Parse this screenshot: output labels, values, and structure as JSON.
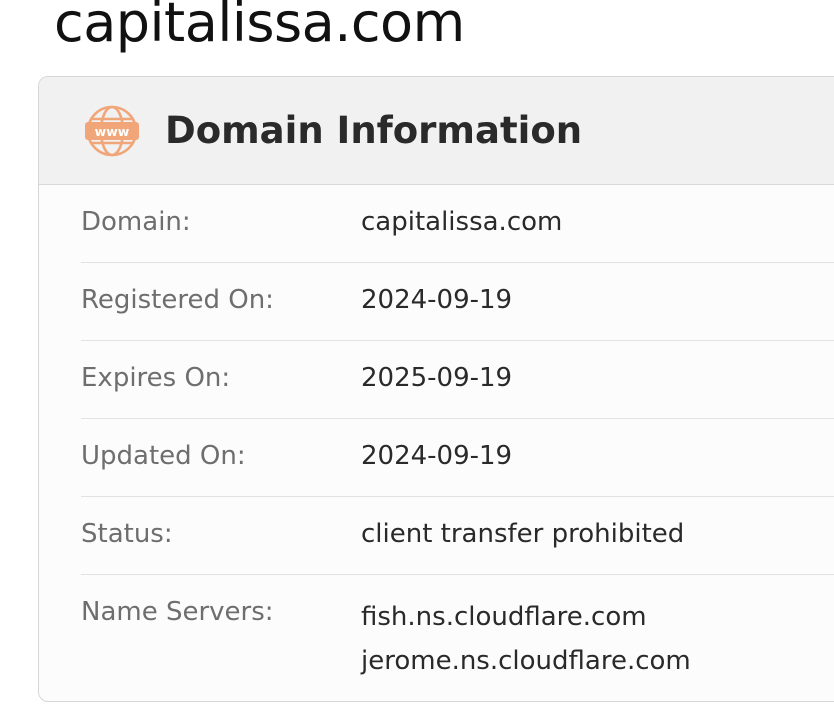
{
  "page": {
    "title": "capitalissa.com"
  },
  "card": {
    "title": "Domain Information",
    "icon": "www-globe-icon",
    "icon_text": "www",
    "icon_color": "#F0A678"
  },
  "domain_info": {
    "domain": {
      "label": "Domain:",
      "value": "capitalissa.com"
    },
    "registered_on": {
      "label": "Registered On:",
      "value": "2024-09-19"
    },
    "expires_on": {
      "label": "Expires On:",
      "value": "2025-09-19"
    },
    "updated_on": {
      "label": "Updated On:",
      "value": "2024-09-19"
    },
    "status": {
      "label": "Status:",
      "value": "client transfer prohibited"
    },
    "name_servers": {
      "label": "Name Servers:",
      "values": [
        "fish.ns.cloudflare.com",
        "jerome.ns.cloudflare.com"
      ]
    }
  }
}
